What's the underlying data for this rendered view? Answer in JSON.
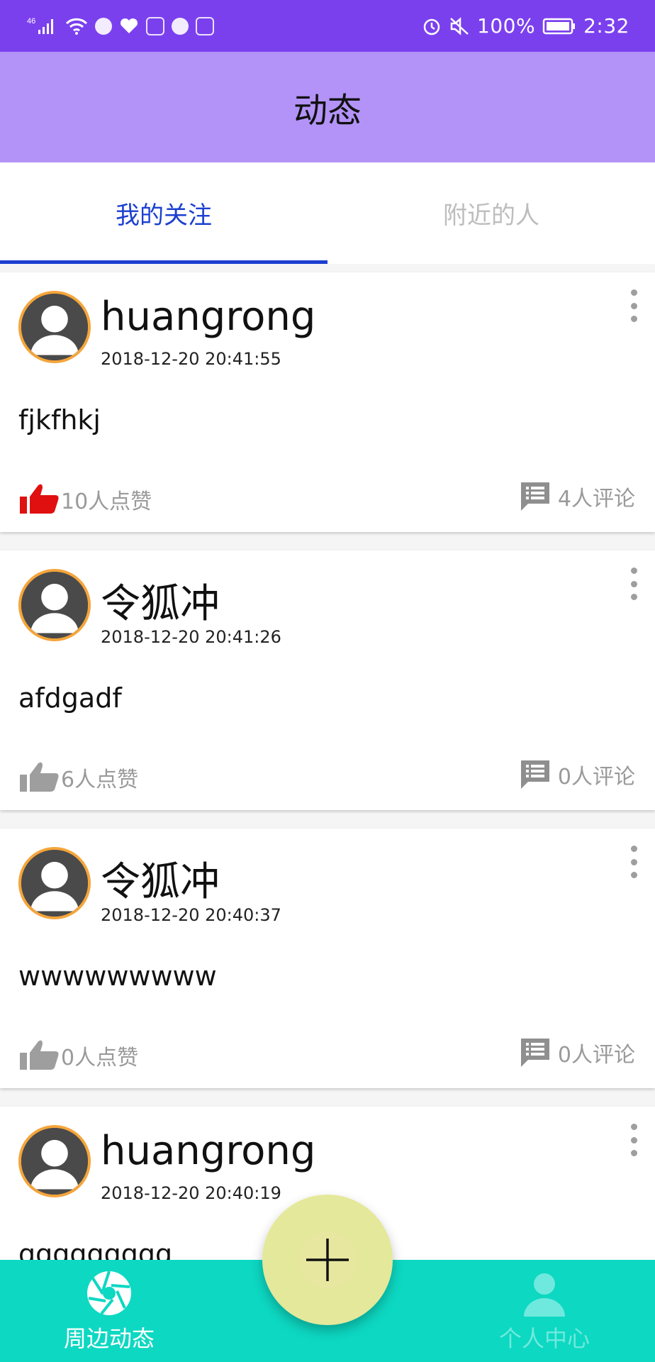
{
  "status_bar": {
    "network": "46",
    "battery": "100%",
    "time": "2:32"
  },
  "header": {
    "title": "动态"
  },
  "tabs": [
    {
      "label": "我的关注",
      "active": true
    },
    {
      "label": "附近的人",
      "active": false
    }
  ],
  "posts": [
    {
      "username": "huangrong",
      "timestamp": "2018-12-20 20:41:55",
      "content": "fjkfhkj",
      "likes": "10人点赞",
      "liked": true,
      "comments": "4人评论"
    },
    {
      "username": "令狐冲",
      "timestamp": "2018-12-20 20:41:26",
      "content": "afdgadf",
      "likes": "6人点赞",
      "liked": false,
      "comments": "0人评论"
    },
    {
      "username": "令狐冲",
      "timestamp": "2018-12-20 20:40:37",
      "content": "wwwwwwwww",
      "likes": "0人点赞",
      "liked": false,
      "comments": "0人评论"
    },
    {
      "username": "huangrong",
      "timestamp": "2018-12-20 20:40:19",
      "content": "ggggggggg",
      "likes": "",
      "liked": false,
      "comments": ""
    }
  ],
  "bottom_nav": [
    {
      "label": "周边动态",
      "icon": "shutter-icon",
      "active": true
    },
    {
      "label": "个人中心",
      "icon": "person-icon",
      "active": false
    }
  ],
  "fab": {
    "icon": "plus-icon"
  },
  "colors": {
    "status_bar": "#7b40ee",
    "title_bar": "#b393f7",
    "tab_active": "#1b3fd0",
    "like_active": "#e01010",
    "like_inactive": "#9e9e9e",
    "bottom_nav": "#0dd8c2",
    "fab": "#e4e89a",
    "avatar_ring": "#f5a53b"
  }
}
